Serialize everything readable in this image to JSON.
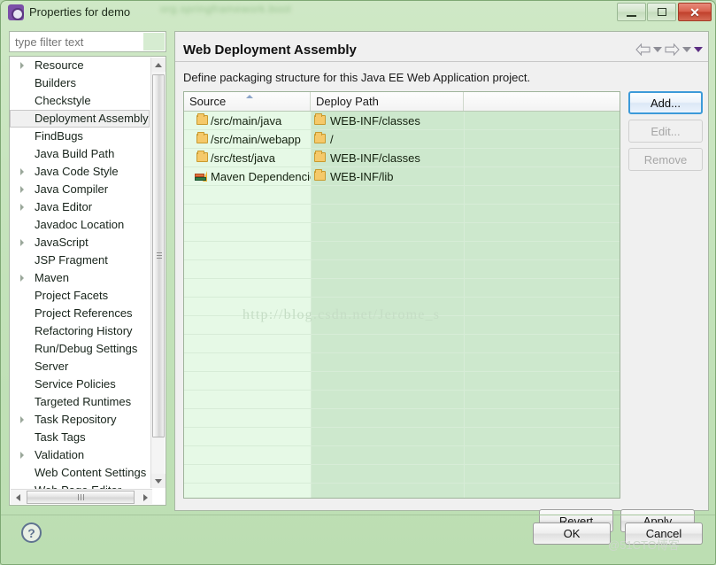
{
  "window": {
    "title": "Properties for demo",
    "app_icon": "gear-icon",
    "blurred_background_text": "org.springframework.boot",
    "controls": {
      "minimize": "_",
      "maximize": "▣",
      "close": "✕"
    }
  },
  "sidebar": {
    "filter": {
      "placeholder": "type filter text",
      "value": ""
    },
    "items": [
      {
        "label": "Resource",
        "expandable": true,
        "selected": false
      },
      {
        "label": "Builders",
        "expandable": false,
        "selected": false
      },
      {
        "label": "Checkstyle",
        "expandable": false,
        "selected": false
      },
      {
        "label": "Deployment Assembly",
        "expandable": false,
        "selected": true
      },
      {
        "label": "FindBugs",
        "expandable": false,
        "selected": false
      },
      {
        "label": "Java Build Path",
        "expandable": false,
        "selected": false
      },
      {
        "label": "Java Code Style",
        "expandable": true,
        "selected": false
      },
      {
        "label": "Java Compiler",
        "expandable": true,
        "selected": false
      },
      {
        "label": "Java Editor",
        "expandable": true,
        "selected": false
      },
      {
        "label": "Javadoc Location",
        "expandable": false,
        "selected": false
      },
      {
        "label": "JavaScript",
        "expandable": true,
        "selected": false
      },
      {
        "label": "JSP Fragment",
        "expandable": false,
        "selected": false
      },
      {
        "label": "Maven",
        "expandable": true,
        "selected": false
      },
      {
        "label": "Project Facets",
        "expandable": false,
        "selected": false
      },
      {
        "label": "Project References",
        "expandable": false,
        "selected": false
      },
      {
        "label": "Refactoring History",
        "expandable": false,
        "selected": false
      },
      {
        "label": "Run/Debug Settings",
        "expandable": false,
        "selected": false
      },
      {
        "label": "Server",
        "expandable": false,
        "selected": false
      },
      {
        "label": "Service Policies",
        "expandable": false,
        "selected": false
      },
      {
        "label": "Targeted Runtimes",
        "expandable": false,
        "selected": false
      },
      {
        "label": "Task Repository",
        "expandable": true,
        "selected": false
      },
      {
        "label": "Task Tags",
        "expandable": false,
        "selected": false
      },
      {
        "label": "Validation",
        "expandable": true,
        "selected": false
      },
      {
        "label": "Web Content Settings",
        "expandable": false,
        "selected": false
      },
      {
        "label": "Web Page Editor",
        "expandable": false,
        "selected": false
      }
    ]
  },
  "page": {
    "title": "Web Deployment Assembly",
    "description": "Define packaging structure for this Java EE Web Application project.",
    "nav": {
      "back_icon": "arrow-left-icon",
      "back_menu_icon": "chevron-down-icon",
      "forward_icon": "arrow-right-icon",
      "forward_menu_icon": "chevron-down-icon",
      "view_menu_icon": "chevron-down-filled-icon"
    }
  },
  "table": {
    "columns": [
      "Source",
      "Deploy Path",
      ""
    ],
    "sort_column": "Source",
    "sort_direction": "ascending",
    "rows": [
      {
        "source": "/src/main/java",
        "source_icon": "folder-icon",
        "deploy_path": "WEB-INF/classes",
        "deploy_icon": "folder-icon"
      },
      {
        "source": "/src/main/webapp",
        "source_icon": "folder-icon",
        "deploy_path": "/",
        "deploy_icon": "folder-icon"
      },
      {
        "source": "/src/test/java",
        "source_icon": "folder-icon",
        "deploy_path": "WEB-INF/classes",
        "deploy_icon": "folder-icon"
      },
      {
        "source": "Maven Dependencies",
        "source_icon": "maven-dependencies-icon",
        "deploy_path": "WEB-INF/lib",
        "deploy_icon": "folder-icon"
      }
    ],
    "empty_row_count": 17
  },
  "side_buttons": [
    {
      "label": "Add...",
      "state": "focused"
    },
    {
      "label": "Edit...",
      "state": "disabled"
    },
    {
      "label": "Remove",
      "state": "disabled"
    }
  ],
  "page_buttons": {
    "revert": "Revert",
    "apply": "Apply"
  },
  "footer": {
    "help_icon": "question-mark-icon",
    "ok": "OK",
    "cancel": "Cancel"
  },
  "watermarks": {
    "table": "http://blog.csdn.net/Jerome_s",
    "footer": "@51CTO博客"
  },
  "colors": {
    "window_chrome": "#c3e2ba",
    "content_background": "#f0f0f0",
    "table_col1": "#e6f9e6",
    "table_col2": "#cde8cd",
    "focus_border": "#3c9ad9",
    "close_button": "#c0402c",
    "folder_icon": "#f5c96a"
  }
}
